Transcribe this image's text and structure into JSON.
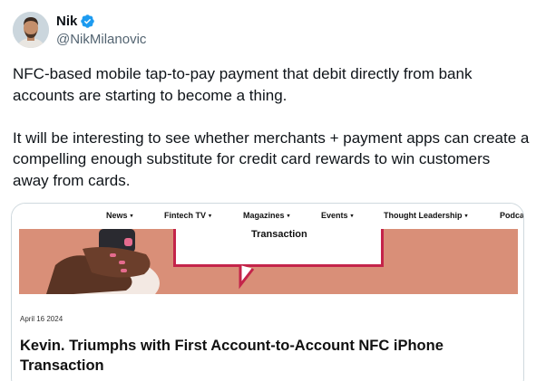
{
  "author": {
    "display_name": "Nik",
    "handle": "@NikMilanovic",
    "verified_icon": "verified-badge-icon",
    "verified_color": "#1d9bf0"
  },
  "tweet": {
    "paragraphs": [
      "NFC-based mobile tap-to-pay payment that debit directly from bank accounts are starting to become a thing.",
      "It will be interesting to see whether merchants + payment apps can create a compelling enough substitute for credit card rewards to win customers away from cards."
    ]
  },
  "link_card": {
    "nav": [
      {
        "label": "News",
        "caret": "▾"
      },
      {
        "label": "Fintech TV",
        "caret": "▾"
      },
      {
        "label": "Magazines",
        "caret": "▾"
      },
      {
        "label": "Events",
        "caret": "▾"
      },
      {
        "label": "Thought Leadership",
        "caret": "▾"
      },
      {
        "label": "Podca"
      }
    ],
    "hero_label": "Transaction",
    "hero_background": "#d98f78",
    "hero_accent": "#c4244a",
    "date": "April 16 2024",
    "headline": "Kevin. Triumphs with First Account-to-Account NFC iPhone Transaction"
  }
}
